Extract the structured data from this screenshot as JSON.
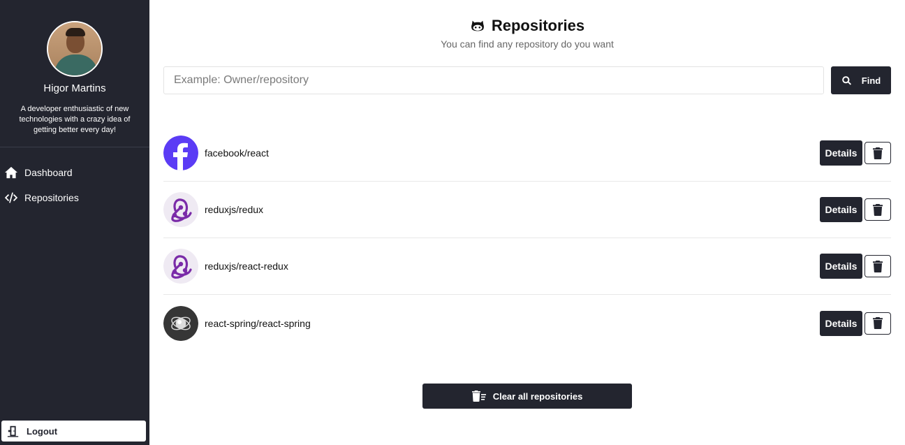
{
  "sidebar": {
    "user_name": "Higor Martins",
    "bio": "A developer enthusiastic of new technologies with a crazy idea of getting better every day!",
    "nav": [
      {
        "label": "Dashboard",
        "icon": "home-icon"
      },
      {
        "label": "Repositories",
        "icon": "code-icon"
      }
    ],
    "logout_label": "Logout"
  },
  "header": {
    "title": "Repositories",
    "subtitle": "You can find any repository do you want"
  },
  "search": {
    "placeholder": "Example: Owner/repository",
    "value": "",
    "button_label": "Find"
  },
  "repositories": [
    {
      "name": "facebook/react",
      "avatar": "facebook-logo",
      "details_label": "Details"
    },
    {
      "name": "reduxjs/redux",
      "avatar": "redux-logo",
      "details_label": "Details"
    },
    {
      "name": "reduxjs/react-redux",
      "avatar": "redux-logo",
      "details_label": "Details"
    },
    {
      "name": "react-spring/react-spring",
      "avatar": "react-spring-logo",
      "details_label": "Details"
    }
  ],
  "clear_all_label": "Clear all repositories",
  "colors": {
    "sidebar_bg": "#23252f",
    "button_bg": "#23252f",
    "facebook_blue": "#5b3cf5",
    "redux_purple": "#7a2ba8"
  }
}
